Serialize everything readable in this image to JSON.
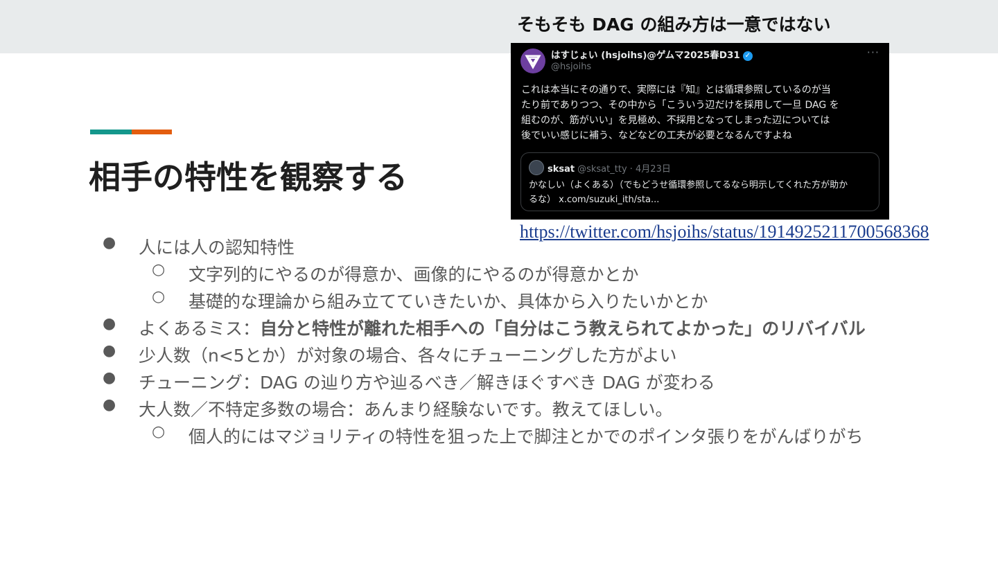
{
  "slide": {
    "title": "相手の特性を観察する",
    "caption": "そもそも DAG の組み方は一意ではない",
    "accent_colors": [
      "#14978c",
      "#e35d0f"
    ]
  },
  "tweet": {
    "display_name": "はすじょい (hsjoihs)@ゲムマ2025春D31",
    "handle": "@hsjoihs",
    "verified_icon": "verified-badge-icon",
    "more_icon": "ellipsis-icon",
    "body_lines": [
      "これは本当にその通りで、実際には『知』とは循環参照しているのが当",
      "たり前でありつつ、その中から「こういう辺だけを採用して一旦 DAG を",
      "組むのが、筋がいい」を見極め、不採用となってしまった辺については",
      "後でいい感じに補う、などなどの工夫が必要となるんですよね"
    ],
    "quote": {
      "name": "sksat",
      "handle_date": "@sksat_tty · 4月23日",
      "body_lines": [
        "かなしい（よくある）（でもどうせ循環参照してるなら明示してくれた方が助か",
        "るな） x.com/suzuki_ith/sta..."
      ]
    },
    "link": "https://twitter.com/hsjoihs/status/1914925211700568368"
  },
  "bullets": {
    "b1": "人には人の認知特性",
    "b1_1": "文字列的にやるのが得意か、画像的にやるのが得意かとか",
    "b1_2": "基礎的な理論から組み立てていきたいか、具体から入りたいかとか",
    "b2_prefix": "よくあるミス：",
    "b2_bold": "自分と特性が離れた相手への「自分はこう教えられてよかった」のリバイバル",
    "b3": "少人数（n<5とか）が対象の場合、各々にチューニングした方がよい",
    "b4": "チューニング：DAG の辿り方や辿るべき／解きほぐすべき DAG が変わる",
    "b5": "大人数／不特定多数の場合：あんまり経験ないです。教えてほしい。",
    "b5_1": "個人的にはマジョリティの特性を狙った上で脚注とかでのポインタ張りをがんばりがち",
    "marker_l1": "●",
    "marker_l2": "○"
  }
}
